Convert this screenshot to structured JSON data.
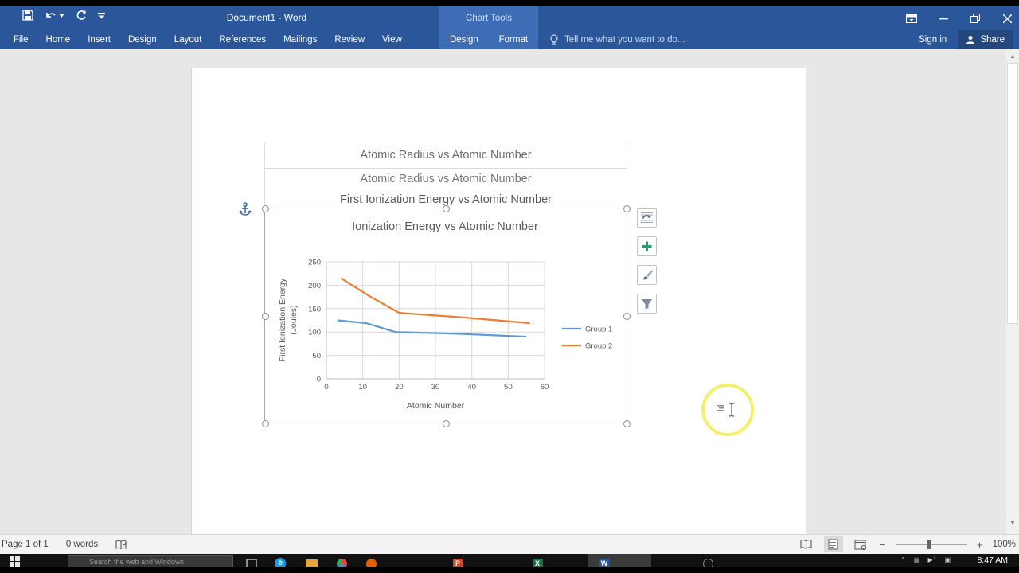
{
  "titlebar": {
    "title": "Document1 - Word",
    "contextual_label": "Chart Tools",
    "qat_icons": [
      "save-icon",
      "undo-icon",
      "redo-icon",
      "customize-qat-icon"
    ],
    "window_controls": [
      "ribbon-display-options",
      "minimize",
      "restore",
      "close"
    ]
  },
  "ribbon": {
    "tabs": [
      "File",
      "Home",
      "Insert",
      "Design",
      "Layout",
      "References",
      "Mailings",
      "Review",
      "View"
    ],
    "contextual_tabs": [
      "Design",
      "Format"
    ],
    "tell_me": "Tell me what you want to do...",
    "sign_in": "Sign in",
    "share": "Share"
  },
  "document": {
    "ghost_titles": [
      "Atomic Radius vs Atomic Number",
      "Atomic Radius vs Atomic Number"
    ],
    "overlay_title": "First Ionization Energy vs Atomic Number"
  },
  "chart_data": {
    "type": "line",
    "title": "Ionization Energy vs Atomic Number",
    "xlabel": "Atomic Number",
    "ylabel": "First Ionization Energy (Joules)",
    "ylabel_lines": [
      "First Ionization Energy",
      "(Joules)"
    ],
    "xlim": [
      0,
      60
    ],
    "ylim": [
      0,
      250
    ],
    "xticks": [
      0,
      10,
      20,
      30,
      40,
      50,
      60
    ],
    "yticks": [
      0,
      50,
      100,
      150,
      200,
      250
    ],
    "grid": true,
    "legend_position": "right",
    "series": [
      {
        "name": "Group 1",
        "color": "#5b9bd5",
        "x": [
          3,
          11,
          19,
          37,
          55
        ],
        "y": [
          125,
          119,
          100,
          96,
          90
        ]
      },
      {
        "name": "Group 2",
        "color": "#ed7d31",
        "x": [
          4,
          12,
          20,
          38,
          56
        ],
        "y": [
          215,
          176,
          141,
          131,
          119
        ]
      }
    ],
    "text_color": "#595959",
    "grid_color": "#d9d9d9",
    "axis_color": "#bfbfbf"
  },
  "chart_ui": {
    "side_buttons": [
      "layout-options",
      "chart-elements",
      "chart-styles",
      "chart-filters"
    ]
  },
  "statusbar": {
    "page_count": "Page 1 of 1",
    "word_count": "0 words",
    "zoom_level": "100%",
    "view_icons": [
      "read-mode",
      "print-layout",
      "web-layout"
    ]
  },
  "taskbar": {
    "search_placeholder": "Search the web and Windows",
    "clock": "8:47 AM",
    "icons": [
      "start",
      "task-view",
      "edge",
      "file-explorer",
      "chrome",
      "firefox",
      "powerpoint",
      "excel",
      "word",
      "cortana"
    ]
  },
  "colors": {
    "titlebar": "#2b579a",
    "contextual_tab": "#3f6db5",
    "series1": "#5b9bd5",
    "series2": "#ed7d31",
    "highlight_ring": "#f0ee46"
  }
}
